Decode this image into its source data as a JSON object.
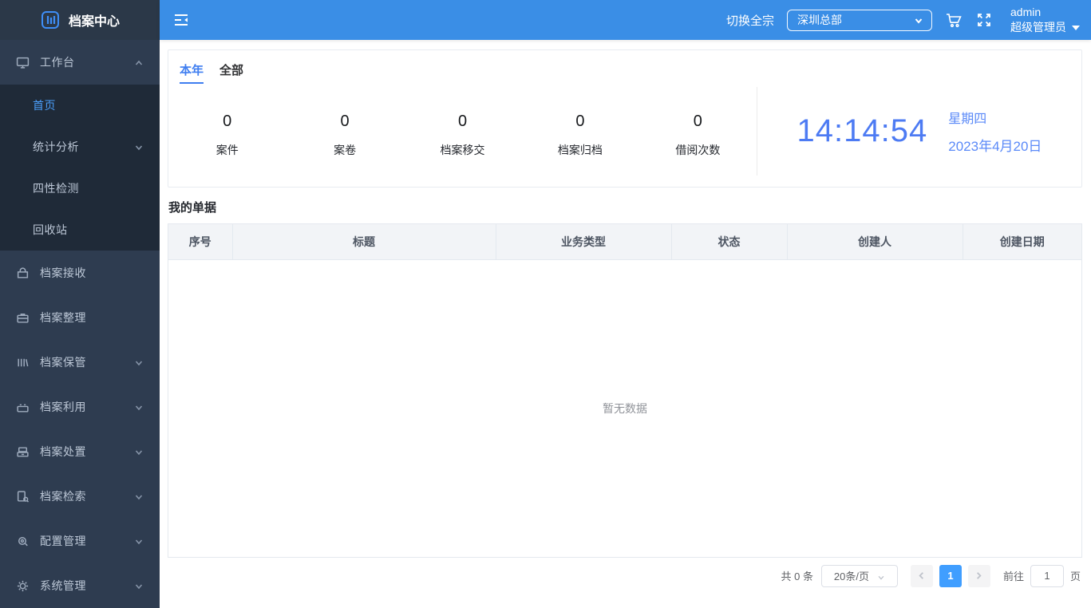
{
  "colors": {
    "topbar_blue": "#3a8ee6",
    "sidebar_bg": "#2e3c50",
    "submenu_bg": "#1f2a38",
    "active_link": "#4a9df8",
    "clock_blue": "#4d7bf3",
    "pagination_active": "#409eff"
  },
  "sidebar": {
    "logo_text": "档案中心",
    "workbench": {
      "label": "工作台",
      "icon": "monitor-icon",
      "state": "expanded"
    },
    "submenu": [
      {
        "label": "首页",
        "active": true
      },
      {
        "label": "统计分析",
        "has_children": true
      },
      {
        "label": "四性检测"
      },
      {
        "label": "回收站"
      }
    ],
    "items": [
      {
        "label": "档案接收",
        "icon": "inbox-icon"
      },
      {
        "label": "档案整理",
        "icon": "briefcase-icon"
      },
      {
        "label": "档案保管",
        "icon": "books-icon",
        "has_children": true
      },
      {
        "label": "档案利用",
        "icon": "toolbox-icon",
        "has_children": true
      },
      {
        "label": "档案处置",
        "icon": "drawer-icon",
        "has_children": true
      },
      {
        "label": "档案检索",
        "icon": "doc-search-icon",
        "has_children": true
      },
      {
        "label": "配置管理",
        "icon": "config-search-icon",
        "has_children": true
      },
      {
        "label": "系统管理",
        "icon": "gear-icon",
        "has_children": true
      }
    ]
  },
  "topbar": {
    "collapse_icon": "menu-fold-icon",
    "switch_label": "切换全宗",
    "org_select_value": "深圳总部",
    "cart_icon": "cart-icon",
    "fullscreen_icon": "fullscreen-icon",
    "username": "admin",
    "role": "超级管理员"
  },
  "overview": {
    "tabs": [
      {
        "label": "本年",
        "active": true
      },
      {
        "label": "全部",
        "active": false
      }
    ],
    "stats": [
      {
        "value": "0",
        "label": "案件"
      },
      {
        "value": "0",
        "label": "案卷"
      },
      {
        "value": "0",
        "label": "档案移交"
      },
      {
        "value": "0",
        "label": "档案归档"
      },
      {
        "value": "0",
        "label": "借阅次数"
      }
    ],
    "clock": {
      "time": "14:14:54",
      "weekday": "星期四",
      "date": "2023年4月20日"
    }
  },
  "documents": {
    "title": "我的单据",
    "columns": [
      "序号",
      "标题",
      "业务类型",
      "状态",
      "创建人",
      "创建日期"
    ],
    "rows": [],
    "empty_text": "暂无数据",
    "pagination": {
      "total_text": "共 0 条",
      "page_size_value": "20条/页",
      "current_page": "1",
      "goto_label": "前往",
      "goto_value": "1",
      "page_unit": "页"
    }
  }
}
